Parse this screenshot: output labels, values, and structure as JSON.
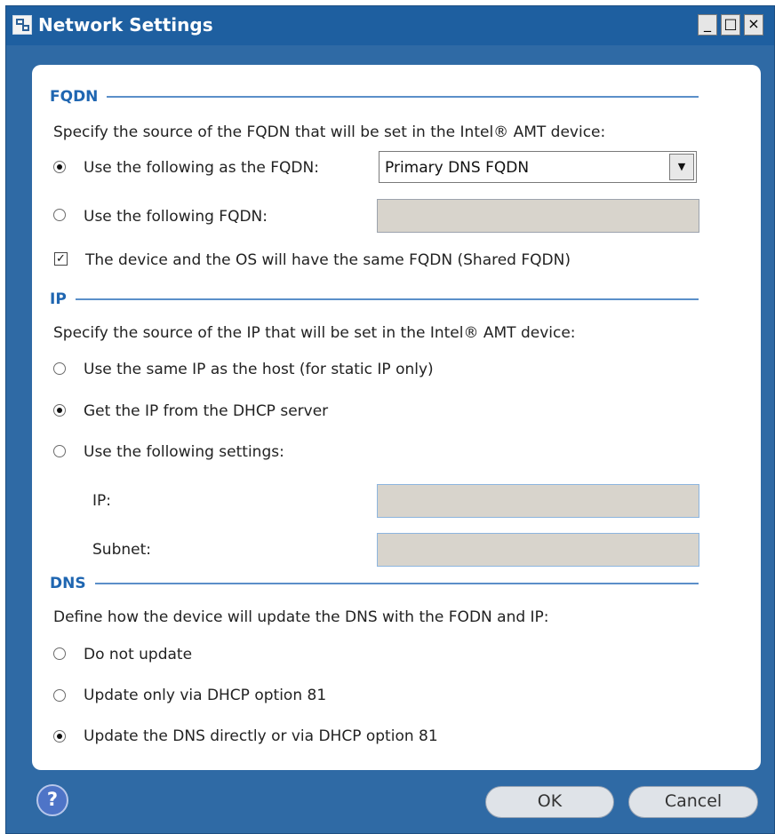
{
  "window": {
    "title": "Network Settings",
    "controls": {
      "minimize": "_",
      "maximize": "□",
      "close": "×"
    }
  },
  "fqdn": {
    "heading": "FQDN",
    "description": "Specify the source of the FQDN that will be set in the Intel® AMT device:",
    "options": [
      {
        "label": "Use the following as the FQDN:",
        "selected": true
      },
      {
        "label": "Use the following FQDN:",
        "selected": false
      }
    ],
    "select_value": "Primary DNS FQDN",
    "custom_value": "",
    "shared_checkbox": {
      "label": "The device and the OS will have the same FQDN (Shared FQDN)",
      "checked": true,
      "mark": "✓"
    }
  },
  "ip": {
    "heading": "IP",
    "description": "Specify the source of the IP that will be set in the Intel® AMT device:",
    "options": [
      {
        "label": "Use the same IP as the host (for static IP only)",
        "selected": false
      },
      {
        "label": "Get the IP from the DHCP server",
        "selected": true
      },
      {
        "label": "Use the following settings:",
        "selected": false
      }
    ],
    "ip_label": "IP:",
    "subnet_label": "Subnet:",
    "ip_value": "",
    "subnet_value": ""
  },
  "dns": {
    "heading": "DNS",
    "description": "Define how the device will update the DNS with the FODN and IP:",
    "options": [
      {
        "label": "Do not update",
        "selected": false
      },
      {
        "label": "Update only via DHCP option 81",
        "selected": false
      },
      {
        "label": "Update the DNS directly or via DHCP option 81",
        "selected": true
      }
    ]
  },
  "footer": {
    "help": "?",
    "ok": "OK",
    "cancel": "Cancel"
  },
  "colors": {
    "titlebar": "#1e5fa0",
    "window": "#2f6aa5",
    "accent": "#1f66b1"
  }
}
